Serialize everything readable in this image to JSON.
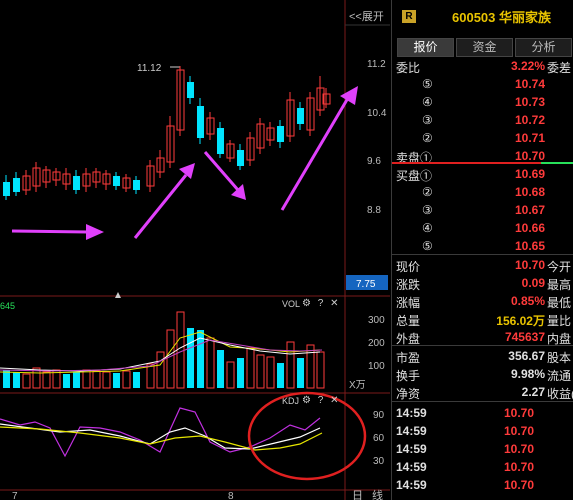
{
  "chart": {
    "expand_label": "<<展开",
    "high_label": "11.12",
    "price_axis": [
      "11.2",
      "10.4",
      "9.6",
      "8.8"
    ],
    "current_price_tag": "7.75",
    "vol_left_value": "645",
    "vol_label": "VOL",
    "vol_axis": [
      "300",
      "200",
      "100"
    ],
    "vol_unit": "X万",
    "kdj_label": "KDJ",
    "kdj_axis": [
      "90",
      "60",
      "30"
    ],
    "date_labels": [
      "7",
      "8"
    ],
    "bottom_right_labels": [
      "日",
      "线"
    ],
    "icons": [
      "gear-icon",
      "help-icon",
      "close-icon",
      "up-arrow-icon"
    ],
    "colors": {
      "up": "#ff3b3b",
      "down": "#00e5ff",
      "annotation": "#e040fb",
      "highlight_circle": "#e02020"
    }
  },
  "quote": {
    "badge": "R",
    "title": "600503 华丽家族",
    "tabs": [
      "报价",
      "资金",
      "分析"
    ],
    "weibi_label": "委比",
    "weibi_value": "3.22%",
    "weicha_label": "委差",
    "ask_rows": [
      {
        "n": "⑤",
        "price": "10.74"
      },
      {
        "n": "④",
        "price": "10.73"
      },
      {
        "n": "③",
        "price": "10.72"
      },
      {
        "n": "②",
        "price": "10.71"
      },
      {
        "n": "卖盘①",
        "price": "10.70"
      }
    ],
    "bid_rows": [
      {
        "n": "买盘①",
        "price": "10.69"
      },
      {
        "n": "②",
        "price": "10.68"
      },
      {
        "n": "③",
        "price": "10.67"
      },
      {
        "n": "④",
        "price": "10.66"
      },
      {
        "n": "⑤",
        "price": "10.65"
      }
    ],
    "stats": [
      {
        "label": "现价",
        "value": "10.70",
        "extra": "今开",
        "color": "red"
      },
      {
        "label": "涨跌",
        "value": "0.09",
        "extra": "最高",
        "color": "red"
      },
      {
        "label": "涨幅",
        "value": "0.85%",
        "extra": "最低",
        "color": "red"
      },
      {
        "label": "总量",
        "value": "156.02万",
        "extra": "量比",
        "color": "wht"
      },
      {
        "label": "外盘",
        "value": "745637",
        "extra": "内盘",
        "color": "red"
      }
    ],
    "stats2": [
      {
        "label": "市盈",
        "value": "356.67",
        "extra": "股本",
        "color": "wht"
      },
      {
        "label": "换手",
        "value": "9.98%",
        "extra": "流通",
        "color": "wht"
      },
      {
        "label": "净资",
        "value": "2.27",
        "extra": "收益(一",
        "color": "wht"
      }
    ],
    "ticks": [
      {
        "time": "14:59",
        "price": "10.70"
      },
      {
        "time": "14:59",
        "price": "10.70"
      },
      {
        "time": "14:59",
        "price": "10.70"
      },
      {
        "time": "14:59",
        "price": "10.70"
      },
      {
        "time": "14:59",
        "price": "10.70"
      }
    ]
  }
}
